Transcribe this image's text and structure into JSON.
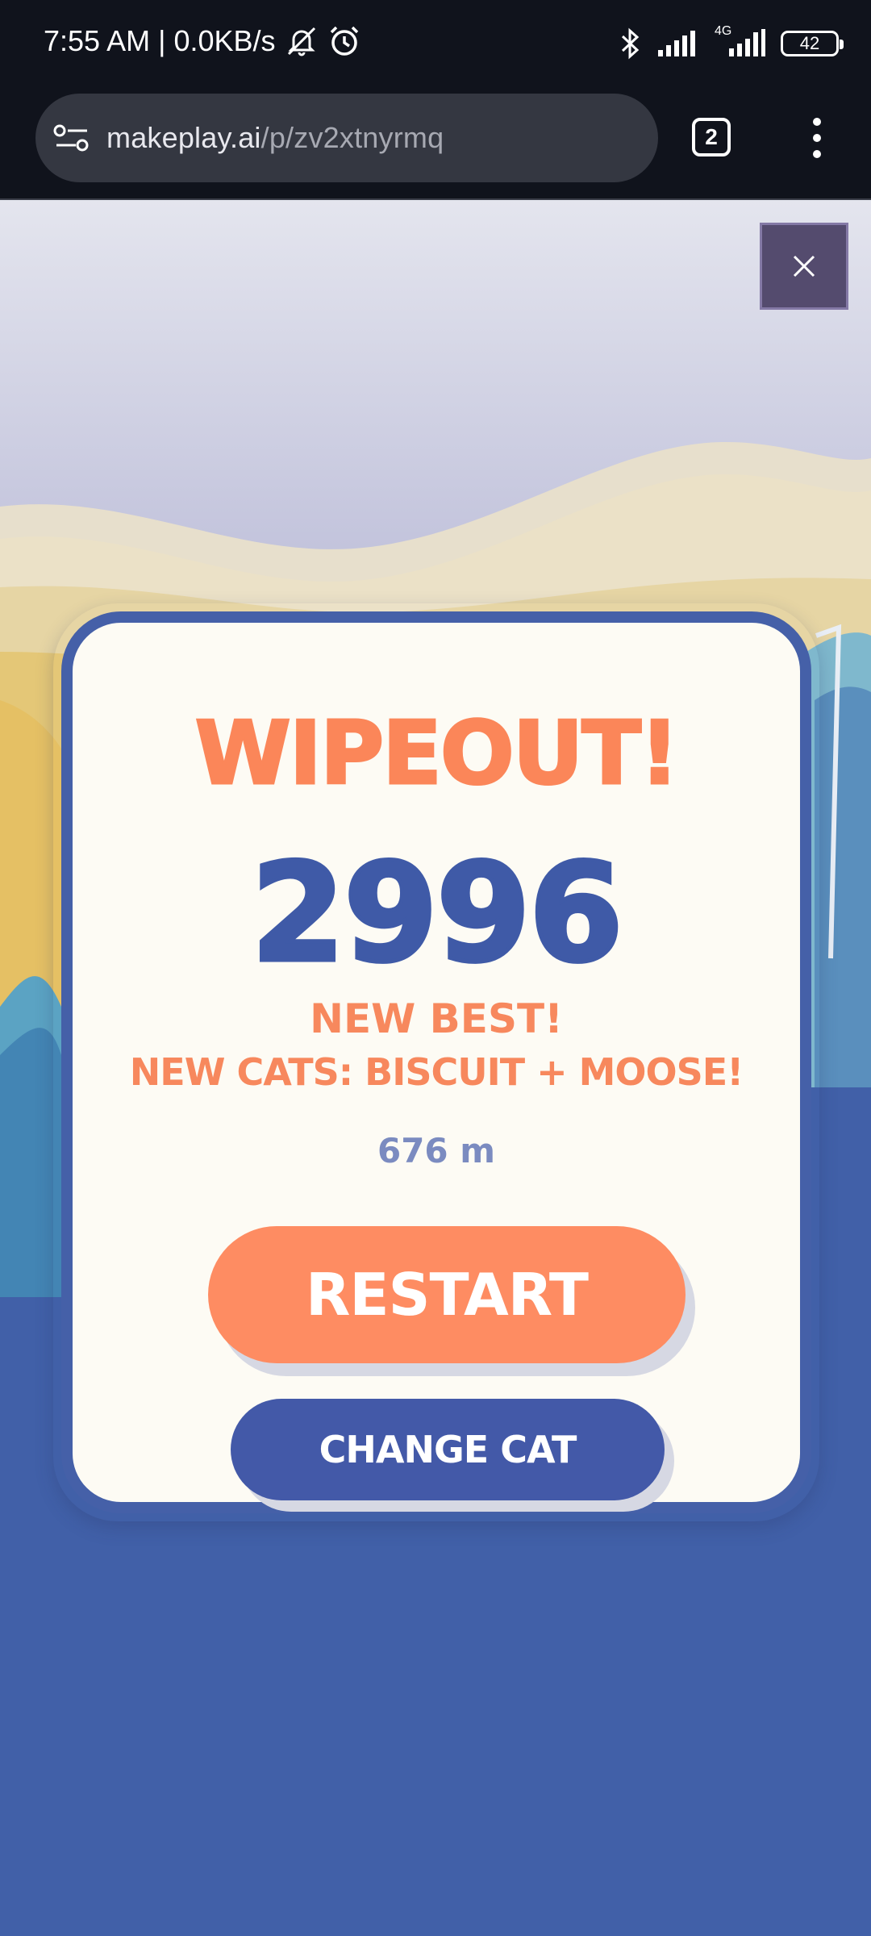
{
  "status_bar": {
    "time_and_speed": "7:55 AM | 0.0KB/s",
    "network_label": "4G",
    "battery": "42"
  },
  "browser": {
    "url_domain": "makeplay.ai",
    "url_path": "/p/zv2xtnyrmq",
    "tab_count": "2"
  },
  "game_over": {
    "title": "WIPEOUT!",
    "score": "2996",
    "best_label": "NEW BEST!",
    "unlock_text": "NEW CATS: BISCUIT + MOOSE!",
    "distance": "676 m",
    "restart_label": "RESTART",
    "change_cat_label": "CHANGE CAT"
  },
  "colors": {
    "accent_orange": "#fb8659",
    "accent_blue": "#4359a8",
    "ocean": "#4160a8",
    "card_bg": "#fdfbf4"
  }
}
